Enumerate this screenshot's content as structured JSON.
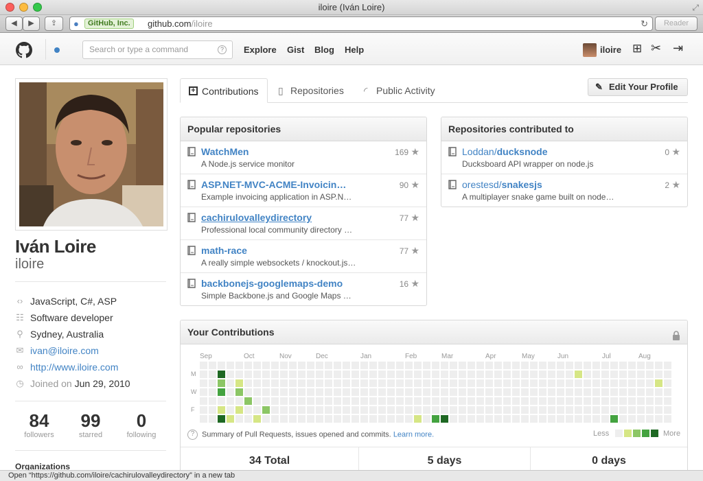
{
  "window": {
    "title": "iloire (Iván Loire)"
  },
  "browser": {
    "identity": "GitHub, Inc.",
    "url_host": "github.com",
    "url_path": "/iloire",
    "reader": "Reader"
  },
  "header": {
    "search_placeholder": "Search or type a command",
    "nav": [
      "Explore",
      "Gist",
      "Blog",
      "Help"
    ],
    "username": "iloire"
  },
  "profile": {
    "full_name": "Iván Loire",
    "username": "iloire",
    "languages": "JavaScript, C#, ASP",
    "job": "Software developer",
    "location": "Sydney, Australia",
    "email": "ivan@iloire.com",
    "website": "http://www.iloire.com",
    "joined_label": "Joined on",
    "joined_date": "Jun 29, 2010",
    "stats": [
      {
        "value": "84",
        "label": "followers"
      },
      {
        "value": "99",
        "label": "starred"
      },
      {
        "value": "0",
        "label": "following"
      }
    ],
    "organizations_label": "Organizations"
  },
  "tabs": [
    "Contributions",
    "Repositories",
    "Public Activity"
  ],
  "edit_profile": "Edit Your Profile",
  "popular": {
    "title": "Popular repositories",
    "repos": [
      {
        "name": "WatchMen",
        "desc": "A Node.js service monitor",
        "stars": "169"
      },
      {
        "name": "ASP.NET-MVC-ACME-Invoicin…",
        "desc": "Example invoicing application in ASP.N…",
        "stars": "90"
      },
      {
        "name": "cachirulovalleydirectory",
        "desc": "Professional local community directory …",
        "stars": "77"
      },
      {
        "name": "math-race",
        "desc": "A really simple websockets / knockout.js…",
        "stars": "77"
      },
      {
        "name": "backbonejs-googlemaps-demo",
        "desc": "Simple Backbone.js and Google Maps …",
        "stars": "16"
      }
    ]
  },
  "contributed": {
    "title": "Repositories contributed to",
    "repos": [
      {
        "owner": "Loddan/",
        "name": "ducksnode",
        "desc": "Ducksboard API wrapper on node.js",
        "stars": "0"
      },
      {
        "owner": "orestesd/",
        "name": "snakesjs",
        "desc": "A multiplayer snake game built on node…",
        "stars": "2"
      }
    ]
  },
  "contributions": {
    "title": "Your Contributions",
    "months": [
      "Sep",
      "Oct",
      "Nov",
      "Dec",
      "Jan",
      "Feb",
      "Mar",
      "Apr",
      "May",
      "Jun",
      "Jul",
      "Aug"
    ],
    "days": [
      "M",
      "W",
      "F"
    ],
    "summary": "Summary of Pull Requests, issues opened and commits.",
    "learn_more": "Learn more.",
    "less": "Less",
    "more": "More",
    "colors": [
      "#eeeeee",
      "#d6e685",
      "#8cc665",
      "#44a340",
      "#1e6823"
    ],
    "active_cells": [
      [
        2,
        1,
        4
      ],
      [
        2,
        2,
        2
      ],
      [
        2,
        3,
        3
      ],
      [
        2,
        5,
        1
      ],
      [
        2,
        6,
        4
      ],
      [
        3,
        6,
        1
      ],
      [
        4,
        2,
        1
      ],
      [
        4,
        3,
        2
      ],
      [
        4,
        5,
        1
      ],
      [
        5,
        4,
        2
      ],
      [
        6,
        6,
        1
      ],
      [
        7,
        5,
        2
      ],
      [
        24,
        6,
        1
      ],
      [
        26,
        6,
        3
      ],
      [
        27,
        6,
        4
      ],
      [
        42,
        1,
        1
      ],
      [
        46,
        6,
        3
      ],
      [
        51,
        2,
        1
      ]
    ],
    "totals": [
      "34 Total",
      "5 days",
      "0 days"
    ]
  },
  "status_bar": "Open “https://github.com/iloire/cachirulovalleydirectory” in a new tab"
}
